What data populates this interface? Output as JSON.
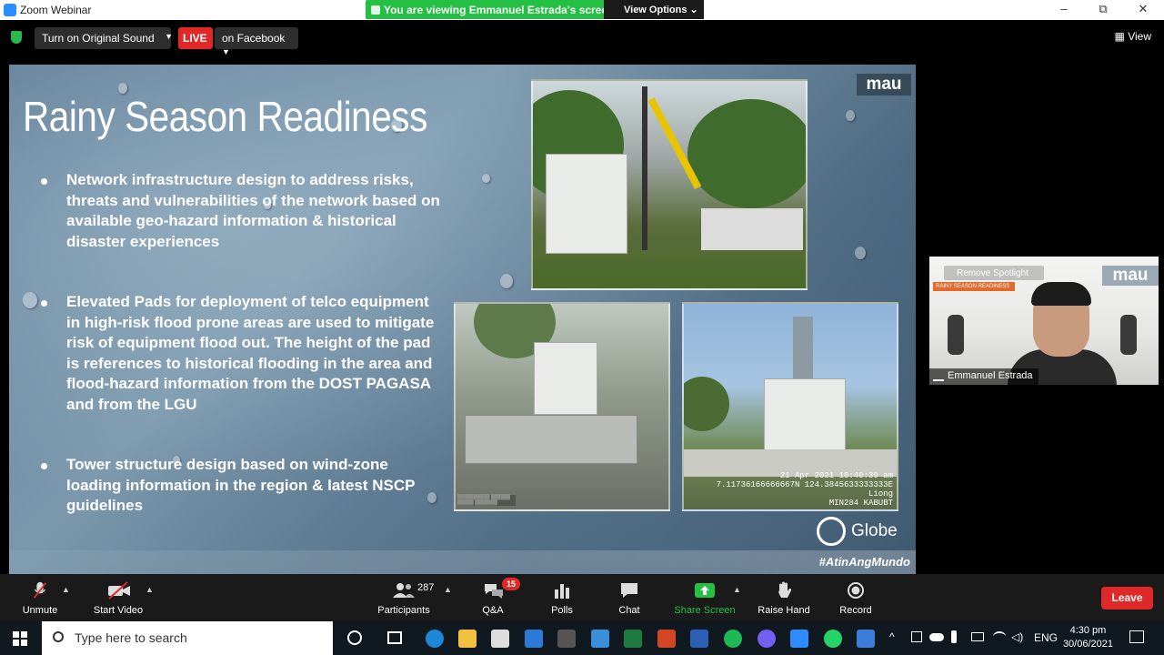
{
  "window": {
    "title": "Zoom Webinar",
    "viewing_banner": "You are viewing Emmanuel Estrada's screen",
    "view_options": "View Options",
    "minimize": "–",
    "maximize": "⧉",
    "close": "✕"
  },
  "meeting_bar": {
    "original_sound": "Turn on Original Sound",
    "live_badge": "LIVE",
    "live_destination": "on Facebook",
    "view_label": "View"
  },
  "slide": {
    "title": "Rainy Season Readiness",
    "bullets": [
      "Network infrastructure design to address risks, threats and vulnerabilities of the network based on available geo-hazard information &  historical disaster experiences",
      "Elevated Pads for deployment of telco equipment in high-risk flood prone areas are used to mitigate risk of equipment flood out. The height of the pad is references to historical flooding in the area and  flood-hazard information from the DOST PAGASA and from the LGU",
      "Tower structure design based on wind-zone loading information in the region & latest NSCP guidelines"
    ],
    "mau_logo": "mau",
    "photo3_stamp": "21 Apr 2021 10:40:39 am\n7.11736166666667N 124.3845633333333E\nLiong\nMIN284 KABUBT",
    "globe_brand": "Globe",
    "hashtag": "#AtinAngMundo"
  },
  "participant": {
    "name": "Emmanuel Estrada",
    "remove_spotlight": "Remove Spotlight",
    "mau_logo": "mau",
    "banner": "RAINY SEASON READINESS"
  },
  "toolbar": {
    "unmute": "Unmute",
    "start_video": "Start Video",
    "participants": "Participants",
    "participant_count": "287",
    "qa": "Q&A",
    "qa_badge": "15",
    "polls": "Polls",
    "chat": "Chat",
    "share_screen": "Share Screen",
    "raise_hand": "Raise Hand",
    "record": "Record",
    "leave": "Leave"
  },
  "taskbar": {
    "search_placeholder": "Type here to search",
    "language": "ENG",
    "time": "4:30 pm",
    "date": "30/06/2021"
  },
  "colors": {
    "zoom_green": "#23c043",
    "live_red": "#e02828",
    "share_green": "#23c043"
  }
}
